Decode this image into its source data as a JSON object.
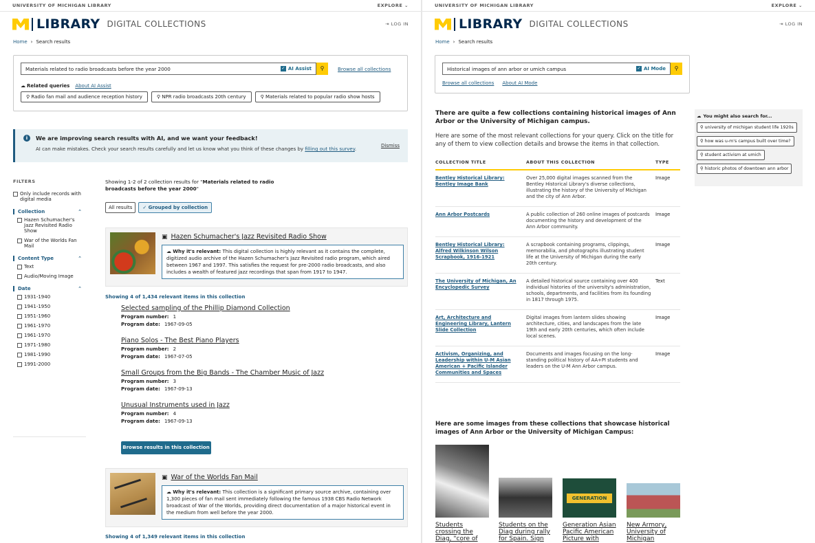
{
  "brand": {
    "university": "UNIVERSITY OF MICHIGAN LIBRARY",
    "explore": "EXPLORE",
    "library": "LIBRARY",
    "digital_collections": "DIGITAL COLLECTIONS",
    "login": "LOG IN"
  },
  "breadcrumb": {
    "home": "Home",
    "current": "Search results"
  },
  "left": {
    "search": {
      "query": "Materials related to radio broadcasts before the year 2000",
      "ai_assist_label": "AI Assist",
      "browse_all": "Browse all collections",
      "related_label": "Related queries",
      "about_ai": "About AI Assist",
      "related": [
        "Radio fan mail and audience reception history",
        "NPR radio broadcasts 20th century",
        "Materials related to popular radio show hosts"
      ]
    },
    "feedback": {
      "title": "We are improving search results with AI, and we want your feedback!",
      "body": "AI can make mistakes. Check your search results carefully and let us know what you think of these changes by",
      "link": "filling out this survey",
      "end": ".",
      "dismiss": "Dismiss"
    },
    "filters": {
      "heading": "FILTERS",
      "digital_media": "Only include records with digital media",
      "groups": [
        {
          "title": "Collection",
          "options": [
            "Hazen Schumacher's Jazz Revisited Radio Show",
            "War of the Worlds Fan Mail"
          ]
        },
        {
          "title": "Content Type",
          "options": [
            "Text",
            "Audio/Moving Image"
          ]
        },
        {
          "title": "Date",
          "options": [
            "1931-1940",
            "1941-1950",
            "1951-1960",
            "1961-1970",
            "1961-1970",
            "1971-1980",
            "1981-1990",
            "1991-2000"
          ]
        }
      ]
    },
    "results": {
      "summary_prefix": "Showing 1-2 of 2 collection results for \"",
      "summary_query": "Materials related to radio broadcasts before the year 2000",
      "summary_suffix": "\"",
      "tab_all": "All results",
      "tab_grouped": "Grouped by collection",
      "why_label": "Why it's relevant:",
      "collections": [
        {
          "title": "Hazen Schumacher's Jazz Revisited Radio Show",
          "why": "This digital collection is highly relevant as it contains the complete, digitized audio archive of the Hazen Schumacher's Jazz Revisited radio program, which aired between 1967 and 1997. This satisfies the request for pre-2000 radio broadcasts, and also includes a wealth of featured jazz recordings that span from 1917 to 1947.",
          "showing": "Showing 4 of 1,434 relevant items in this collection",
          "program_number_label": "Program number:",
          "program_date_label": "Program date:",
          "items": [
            {
              "title": "Selected sampling of the Phillip Diamond Collection",
              "number": "1",
              "date": "1967-09-05"
            },
            {
              "title": "Piano Solos - The Best Piano Players",
              "number": "2",
              "date": "1967-07-05"
            },
            {
              "title": "Small Groups from the Big Bands - The Chamber Music of Jazz",
              "number": "3",
              "date": "1967-09-13"
            },
            {
              "title": "Unusual Instruments used in Jazz",
              "number": "4",
              "date": "1967-09-13"
            }
          ],
          "browse_button": "Browse results in this collection"
        },
        {
          "title": "War of the Worlds Fan Mail",
          "why": "This collection is a significant primary source archive, containing over 1,300 pieces of fan mail sent immediately following the famous 1938 CBS Radio Network broadcast of War of the Worlds, providing direct documentation of a major historical event in the medium from well before the year 2000.",
          "showing": "Showing 4 of 1,349 relevant items in this collection"
        }
      ]
    }
  },
  "right": {
    "search": {
      "query": "Historical images of ann arbor or umich campus",
      "ai_mode_label": "AI Mode",
      "browse_all": "Browse all collections",
      "about_ai": "About AI Mode"
    },
    "intro_heading": "There are quite a few collections containing historical images of Ann Arbor or the University of Michigan campus.",
    "intro_body": "Here are some of the most relevant collections for your query. Click on the title for any of them to view collection details and browse the items in that collection.",
    "table": {
      "headers": [
        "COLLECTION TITLE",
        "ABOUT THIS COLLECTION",
        "TYPE"
      ],
      "rows": [
        {
          "title": "Bentley Historical Library: Bentley Image Bank",
          "about": "Over 25,000 digital images scanned from the Bentley Historical Library's diverse collections, illustrating the history of the University of Michigan and the city of Ann Arbor.",
          "type": "Image"
        },
        {
          "title": "Ann Arbor Postcards",
          "about": "A public collection of 260 online images of postcards documenting the history and development of the Ann Arbor community.",
          "type": "Image"
        },
        {
          "title": "Bentley Historical Library: Alfred Wilkinson Wilson Scrapbook, 1916-1921",
          "about": "A scrapbook containing programs, clippings, memorabilia, and photographs illustrating student life at the University of Michigan during the early 20th century.",
          "type": "Image"
        },
        {
          "title": "The University of Michigan, An Encyclopedic Survey",
          "about": "A detailed historical source containing over 400 individual histories of the university's administration, schools, departments, and facilities from its founding in 1817 through 1975.",
          "type": "Text"
        },
        {
          "title": "Art, Architecture and Engineering Library, Lantern Slide Collection",
          "about": "Digital images from lantern slides showing architecture, cities, and landscapes from the late 19th and early 20th centuries, which often include local scenes.",
          "type": "Image"
        },
        {
          "title": "Activism, Organizing, and Leadership within U-M Asian American + Pacific Islander Communities and Spaces",
          "about": "Documents and images focusing on the long-standing political history of AA+PI students and leaders on the U-M Ann Arbor campus.",
          "type": "Image"
        }
      ]
    },
    "images_heading": "Here are some images from these collections that showcase historical images of Ann Arbor or the University of Michigan Campus:",
    "images": [
      "Students crossing the Diag, \"core of academic activity,\"",
      "Students on the Diag during rally for Spain. Sign",
      "Generation Asian Pacific American Picture with",
      "New Armory, University of Michigan"
    ],
    "poster_text": "GENERATION",
    "suggest": {
      "title": "You might also search for...",
      "items": [
        "university of michigan student life 1920s",
        "how was u-m's campus built over time?",
        "student activism at umich",
        "historic photos of downtown ann arbor"
      ]
    }
  }
}
